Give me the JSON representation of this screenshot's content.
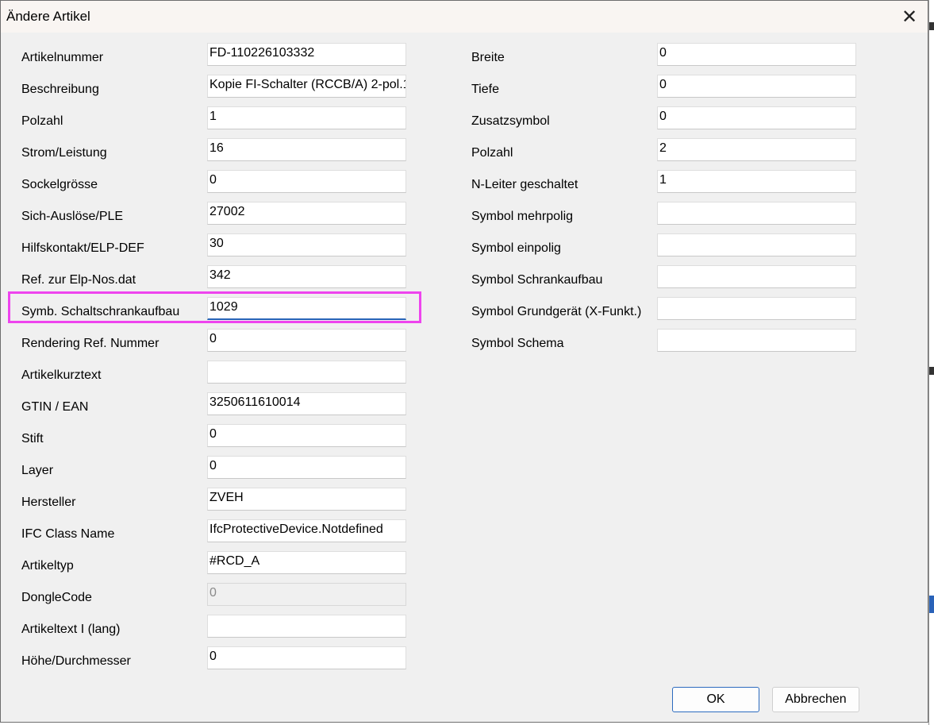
{
  "window": {
    "title": "Ändere Artikel"
  },
  "left_fields": [
    {
      "label": "Artikelnummer",
      "value": "FD-110226103332"
    },
    {
      "label": "Beschreibung",
      "value": "Kopie FI-Schalter (RCCB/A) 2-pol.1"
    },
    {
      "label": "Polzahl",
      "value": "1"
    },
    {
      "label": "Strom/Leistung",
      "value": "16"
    },
    {
      "label": "Sockelgrösse",
      "value": "0"
    },
    {
      "label": "Sich-Auslöse/PLE",
      "value": "27002"
    },
    {
      "label": "Hilfskontakt/ELP-DEF",
      "value": "30"
    },
    {
      "label": "Ref. zur Elp-Nos.dat",
      "value": "342"
    },
    {
      "label": "Symb. Schaltschrankaufbau",
      "value": "1029"
    },
    {
      "label": "Rendering Ref. Nummer",
      "value": "0"
    },
    {
      "label": "Artikelkurztext",
      "value": ""
    },
    {
      "label": "GTIN / EAN",
      "value": "3250611610014"
    },
    {
      "label": "Stift",
      "value": "0"
    },
    {
      "label": "Layer",
      "value": "0"
    },
    {
      "label": "Hersteller",
      "value": "ZVEH"
    },
    {
      "label": "IFC Class Name",
      "value": "IfcProtectiveDevice.Notdefined"
    },
    {
      "label": "Artikeltyp",
      "value": "#RCD_A"
    },
    {
      "label": "DongleCode",
      "value": "0"
    },
    {
      "label": "Artikeltext I (lang)",
      "value": ""
    },
    {
      "label": "Höhe/Durchmesser",
      "value": "0"
    }
  ],
  "right_fields": [
    {
      "label": "Breite",
      "value": "0"
    },
    {
      "label": "Tiefe",
      "value": "0"
    },
    {
      "label": "Zusatzsymbol",
      "value": "0"
    },
    {
      "label": "Polzahl",
      "value": "2"
    },
    {
      "label": "N-Leiter geschaltet",
      "value": "1"
    },
    {
      "label": "Symbol mehrpolig",
      "value": ""
    },
    {
      "label": "Symbol einpolig",
      "value": ""
    },
    {
      "label": "Symbol Schrankaufbau",
      "value": ""
    },
    {
      "label": "Symbol Grundgerät (X-Funkt.)",
      "value": ""
    },
    {
      "label": "Symbol Schema",
      "value": ""
    }
  ],
  "buttons": {
    "ok": "OK",
    "cancel": "Abbrechen"
  },
  "icons": {
    "close": "close-icon"
  },
  "colors": {
    "highlight": "#ee44ee",
    "focus": "#2962b8",
    "default_button_border": "#2c6bbf"
  }
}
